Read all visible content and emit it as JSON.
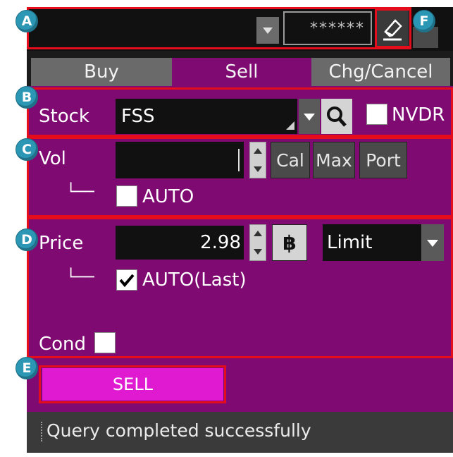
{
  "annotations": {
    "a": "A",
    "b": "B",
    "c": "C",
    "d": "D",
    "e": "E",
    "f": "F"
  },
  "account": {
    "name": "",
    "password": "******"
  },
  "tabs": {
    "buy": "Buy",
    "sell": "Sell",
    "chg_cancel": "Chg/Cancel",
    "active": "Sell"
  },
  "stock": {
    "label": "Stock",
    "value": "FSS",
    "nvdr_label": "NVDR",
    "nvdr_checked": false
  },
  "volume": {
    "label": "Vol",
    "value": "",
    "cal_label": "Cal",
    "max_label": "Max",
    "port_label": "Port",
    "auto_label": "AUTO",
    "auto_checked": false,
    "tree_mark": "└──"
  },
  "price": {
    "label": "Price",
    "value": "2.98",
    "currency_icon": "฿",
    "type": "Limit",
    "auto_label": "AUTO(Last)",
    "auto_checked": true,
    "tree_mark": "└──"
  },
  "cond": {
    "label": "Cond",
    "checked": false
  },
  "action": {
    "label": "SELL"
  },
  "status": {
    "message": "Query completed successfully"
  },
  "colors": {
    "panel": "#7e0a72",
    "sell_button": "#df1ad0",
    "annotation_border": "#e50d1c",
    "badge": "#2b97b4"
  }
}
